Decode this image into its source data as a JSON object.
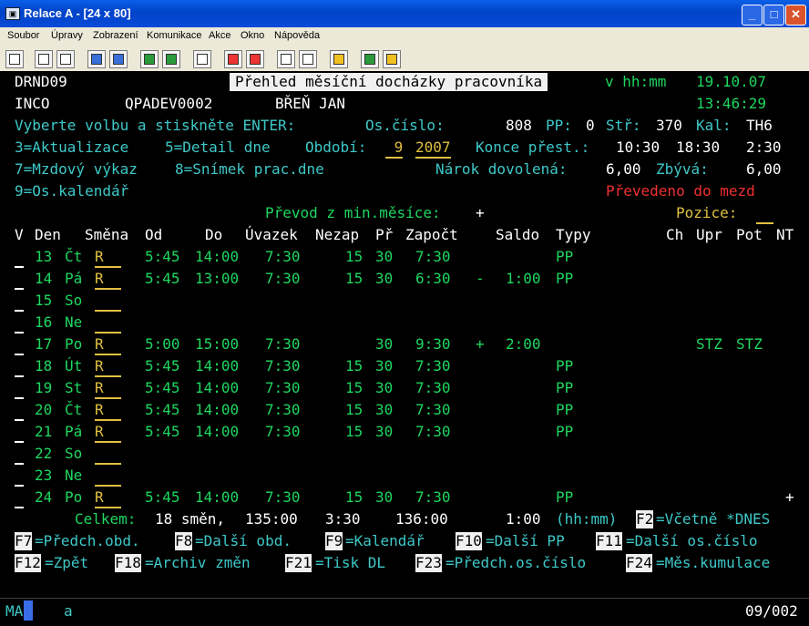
{
  "window": {
    "title": "Relace A - [24 x 80]",
    "min": "_",
    "max": "□",
    "close": "✕",
    "app_icon_glyph": "▣"
  },
  "menu": [
    "Soubor",
    "Úpravy",
    "Zobrazení",
    "Komunikace",
    "Akce",
    "Okno",
    "Nápověda"
  ],
  "header": {
    "program": "DRND09",
    "screen_title": "Přehled měsíční docházky pracovníka",
    "time_format": "v hh:mm",
    "date": "19.10.07",
    "company": "INCO",
    "device": "QPADEV0002",
    "employee": "BŘEŇ JAN",
    "time": "13:46:29"
  },
  "info": {
    "instruction": "Vyberte volbu a stiskněte ENTER:",
    "os_cislo_label": "Os.číslo:",
    "os_cislo": "808",
    "pp_label": "PP:",
    "pp": "0",
    "str_label": "Stř:",
    "str": "370",
    "kal_label": "Kal:",
    "kal": "TH6",
    "opt3": "3=Aktualizace",
    "opt5": "5=Detail dne",
    "obdobi_label": "Období:",
    "obdobi_month": " 9",
    "obdobi_year": "2007",
    "konce_label": "Konce přest.:",
    "konce_1": "10:30",
    "konce_2": "18:30",
    "konce_3": "2:30",
    "opt7": "7=Mzdový výkaz",
    "opt8": "8=Snímek prac.dne",
    "narok_label": "Nárok dovolená:",
    "narok": "6,00",
    "zbyva_label": "Zbývá:",
    "zbyva": "6,00",
    "opt9": "9=Os.kalendář",
    "prevedeno": "Převedeno do mezd",
    "prevod_label": "Převod z min.měsíce:",
    "prevod": "+",
    "pozice_label": "Pozice:",
    "pozice_value": "  "
  },
  "columns": {
    "v": "V",
    "den": "Den",
    "smena": "Směna",
    "od": "Od",
    "do": "Do",
    "uvazek": "Úvazek",
    "nezap": "Nezap",
    "pr": "Př",
    "zapocet": "Započt",
    "saldo": "Saldo",
    "typy": "Typy",
    "ch": "Ch",
    "upr": "Upr",
    "pot": "Pot",
    "nt": "NT"
  },
  "rows": [
    {
      "day": "13",
      "dow": "Čt",
      "shift": "R  ",
      "od": "5:45",
      "do": "14:00",
      "uvazek": "7:30",
      "nezap": "15",
      "pr": "30",
      "zap": "7:30",
      "sign": "",
      "saldo": "",
      "typy": "PP",
      "upr": "",
      "pot": ""
    },
    {
      "day": "14",
      "dow": "Pá",
      "shift": "R  ",
      "od": "5:45",
      "do": "13:00",
      "uvazek": "7:30",
      "nezap": "15",
      "pr": "30",
      "zap": "6:30",
      "sign": "-",
      "saldo": "1:00",
      "typy": "PP",
      "upr": "",
      "pot": ""
    },
    {
      "day": "15",
      "dow": "So",
      "shift": "   ",
      "od": "",
      "do": "",
      "uvazek": "",
      "nezap": "",
      "pr": "",
      "zap": "",
      "sign": "",
      "saldo": "",
      "typy": "",
      "upr": "",
      "pot": ""
    },
    {
      "day": "16",
      "dow": "Ne",
      "shift": "   ",
      "od": "",
      "do": "",
      "uvazek": "",
      "nezap": "",
      "pr": "",
      "zap": "",
      "sign": "",
      "saldo": "",
      "typy": "",
      "upr": "",
      "pot": ""
    },
    {
      "day": "17",
      "dow": "Po",
      "shift": "R  ",
      "od": "5:00",
      "do": "15:00",
      "uvazek": "7:30",
      "nezap": "",
      "pr": "30",
      "zap": "9:30",
      "sign": "+",
      "saldo": "2:00",
      "typy": "",
      "upr": "STZ",
      "pot": "STZ"
    },
    {
      "day": "18",
      "dow": "Út",
      "shift": "R  ",
      "od": "5:45",
      "do": "14:00",
      "uvazek": "7:30",
      "nezap": "15",
      "pr": "30",
      "zap": "7:30",
      "sign": "",
      "saldo": "",
      "typy": "PP",
      "upr": "",
      "pot": ""
    },
    {
      "day": "19",
      "dow": "St",
      "shift": "R  ",
      "od": "5:45",
      "do": "14:00",
      "uvazek": "7:30",
      "nezap": "15",
      "pr": "30",
      "zap": "7:30",
      "sign": "",
      "saldo": "",
      "typy": "PP",
      "upr": "",
      "pot": ""
    },
    {
      "day": "20",
      "dow": "Čt",
      "shift": "R  ",
      "od": "5:45",
      "do": "14:00",
      "uvazek": "7:30",
      "nezap": "15",
      "pr": "30",
      "zap": "7:30",
      "sign": "",
      "saldo": "",
      "typy": "PP",
      "upr": "",
      "pot": ""
    },
    {
      "day": "21",
      "dow": "Pá",
      "shift": "R  ",
      "od": "5:45",
      "do": "14:00",
      "uvazek": "7:30",
      "nezap": "15",
      "pr": "30",
      "zap": "7:30",
      "sign": "",
      "saldo": "",
      "typy": "PP",
      "upr": "",
      "pot": ""
    },
    {
      "day": "22",
      "dow": "So",
      "shift": "   ",
      "od": "",
      "do": "",
      "uvazek": "",
      "nezap": "",
      "pr": "",
      "zap": "",
      "sign": "",
      "saldo": "",
      "typy": "",
      "upr": "",
      "pot": ""
    },
    {
      "day": "23",
      "dow": "Ne",
      "shift": "   ",
      "od": "",
      "do": "",
      "uvazek": "",
      "nezap": "",
      "pr": "",
      "zap": "",
      "sign": "",
      "saldo": "",
      "typy": "",
      "upr": "",
      "pot": ""
    },
    {
      "day": "24",
      "dow": "Po",
      "shift": "R  ",
      "od": "5:45",
      "do": "14:00",
      "uvazek": "7:30",
      "nezap": "15",
      "pr": "30",
      "zap": "7:30",
      "sign": "",
      "saldo": "",
      "typy": "PP",
      "upr": "",
      "pot": ""
    }
  ],
  "more": "+",
  "summary": {
    "label": "Celkem:",
    "shifts": "18 směn,",
    "uvazek": "135:00",
    "nezap": "3:30",
    "zapocet": "136:00",
    "saldo": "1:00",
    "unit": "(hh:mm)",
    "f2": "F2",
    "f2_label": "=Včetně *DNES"
  },
  "fkeys_row1": [
    {
      "key": "F7",
      "label": "=Předch.obd."
    },
    {
      "key": "F8",
      "label": "=Další obd."
    },
    {
      "key": "F9",
      "label": "=Kalendář"
    },
    {
      "key": "F10",
      "label": "=Další PP"
    },
    {
      "key": "F11",
      "label": "=Další os.číslo"
    }
  ],
  "fkeys_row2": [
    {
      "key": "F12",
      "label": "=Zpět"
    },
    {
      "key": "F18",
      "label": "=Archiv změn"
    },
    {
      "key": "F21",
      "label": "=Tisk DL"
    },
    {
      "key": "F23",
      "label": "=Předch.os.číslo"
    },
    {
      "key": "F24",
      "label": "=Měs.kumulace"
    }
  ],
  "status": {
    "mode": "MA",
    "input": "a",
    "position": "09/002"
  }
}
